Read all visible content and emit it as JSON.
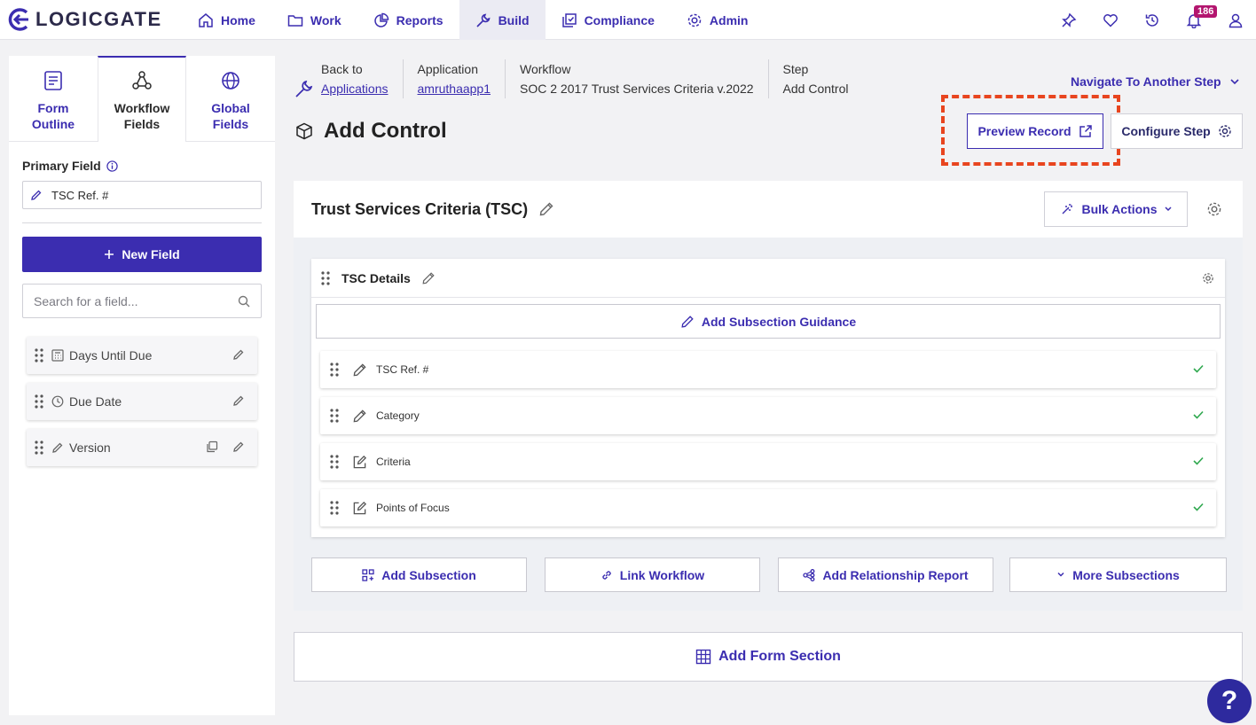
{
  "brand": {
    "name": "LOGICGATE"
  },
  "nav": {
    "items": [
      {
        "label": "Home",
        "icon": "home-icon"
      },
      {
        "label": "Work",
        "icon": "folder-icon"
      },
      {
        "label": "Reports",
        "icon": "pie-chart-icon"
      },
      {
        "label": "Build",
        "icon": "wrench-icon"
      },
      {
        "label": "Compliance",
        "icon": "copy-check-icon"
      },
      {
        "label": "Admin",
        "icon": "gear-icon"
      }
    ],
    "notification_count": "186"
  },
  "sidebar": {
    "tabs": [
      {
        "line1": "Form",
        "line2": "Outline"
      },
      {
        "line1": "Workflow",
        "line2": "Fields"
      },
      {
        "line1": "Global",
        "line2": "Fields"
      }
    ],
    "primary_field_label": "Primary Field",
    "primary_field_value": "TSC Ref. #",
    "new_field_label": "New Field",
    "search_placeholder": "Search for a field...",
    "fields": [
      {
        "label": "Days Until Due",
        "icon": "calculator-icon"
      },
      {
        "label": "Due Date",
        "icon": "clock-icon"
      },
      {
        "label": "Version",
        "icon": "pencil-icon"
      }
    ]
  },
  "breadcrumb": {
    "back_label": "Back to",
    "back_link": "Applications",
    "application_label": "Application",
    "application_value": "amruthaapp1",
    "workflow_label": "Workflow",
    "workflow_value": "SOC 2 2017 Trust Services Criteria v.2022",
    "step_label": "Step",
    "step_value": "Add Control"
  },
  "navigate_label": "Navigate To Another Step",
  "page_title": "Add Control",
  "preview_label": "Preview Record",
  "configure_label": "Configure Step",
  "section": {
    "title": "Trust Services Criteria (TSC)",
    "bulk_actions_label": "Bulk Actions",
    "subsection": {
      "title": "TSC Details",
      "guidance_label": "Add Subsection Guidance",
      "rows": [
        {
          "label": "TSC Ref. #",
          "icon": "pencil-icon"
        },
        {
          "label": "Category",
          "icon": "pencil-icon"
        },
        {
          "label": "Criteria",
          "icon": "edit-box-icon"
        },
        {
          "label": "Points of Focus",
          "icon": "edit-box-icon"
        }
      ]
    },
    "bottom_buttons": [
      "Add Subsection",
      "Link Workflow",
      "Add Relationship Report",
      "More Subsections"
    ]
  },
  "add_form_section_label": "Add Form Section",
  "help_label": "?"
}
